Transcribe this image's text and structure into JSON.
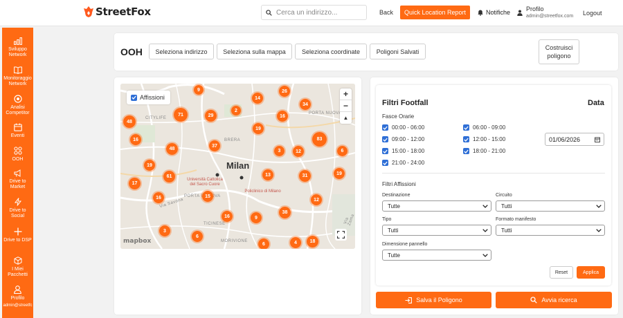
{
  "header": {
    "brand": "StreetFox",
    "search_placeholder": "Cerca un indirizzo...",
    "back": "Back",
    "quick_report": "Quick Location Report",
    "notifications": "Notifiche",
    "profile_name": "Profilo",
    "profile_email": "admin@streetfox.com",
    "logout": "Logout"
  },
  "sidebar": {
    "items": [
      {
        "label": "Sviluppo Network",
        "icon": "bar-chart-icon"
      },
      {
        "label": "Monitoraggio Network",
        "icon": "book-icon"
      },
      {
        "label": "Analisi Competitor",
        "icon": "target-icon"
      },
      {
        "label": "Eventi",
        "icon": "calendar-icon"
      },
      {
        "label": "OOH",
        "icon": "grid-icon"
      },
      {
        "label": "Drive to Market",
        "icon": "megaphone-icon"
      },
      {
        "label": "Drive to Social",
        "icon": "bolt-icon"
      },
      {
        "label": "Drive to DSP",
        "icon": "plus-icon"
      },
      {
        "label": "I Miei Pacchetti",
        "icon": "box-icon"
      },
      {
        "label": "Profilo",
        "icon": "user-icon"
      },
      {
        "label": "admin@streetfc",
        "icon": ""
      }
    ]
  },
  "toolbar": {
    "title": "OOH",
    "tabs": [
      "Seleziona indirizzo",
      "Seleziona sulla mappa",
      "Seleziona coordinate",
      "Poligoni Salvati"
    ],
    "build_polygon": "Costruisci poligono"
  },
  "map": {
    "layer_toggle": "Affissioni",
    "city": "Milan",
    "attribution": "mapbox",
    "labels": {
      "citylife": "CITYLIFE",
      "brera": "BRERA",
      "portanuova": "PORTA NUOVA",
      "porta_genova": "PORTA GENOVA",
      "morivione": "MORIVIONE",
      "ticinese": "TICINESE",
      "via_savona": "Via Savona",
      "via_zama": "Via Zama"
    },
    "pois": [
      {
        "label": "Università Cattolica del Sacro Cuore"
      },
      {
        "label": "Policlinico di Milano"
      }
    ],
    "clusters": [
      {
        "count": "9"
      },
      {
        "count": "26"
      },
      {
        "count": "14"
      },
      {
        "count": "34"
      },
      {
        "count": "48"
      },
      {
        "count": "71"
      },
      {
        "count": "29"
      },
      {
        "count": "2"
      },
      {
        "count": "16"
      },
      {
        "count": "19"
      },
      {
        "count": "16"
      },
      {
        "count": "83"
      },
      {
        "count": "6"
      },
      {
        "count": "48"
      },
      {
        "count": "37"
      },
      {
        "count": "3"
      },
      {
        "count": "12"
      },
      {
        "count": "19"
      },
      {
        "count": "61"
      },
      {
        "count": "13"
      },
      {
        "count": "31"
      },
      {
        "count": "19"
      },
      {
        "count": "17"
      },
      {
        "count": "16"
      },
      {
        "count": "15"
      },
      {
        "count": "12"
      },
      {
        "count": "38"
      },
      {
        "count": "16"
      },
      {
        "count": "9"
      },
      {
        "count": "3"
      },
      {
        "count": "6"
      },
      {
        "count": "6"
      },
      {
        "count": "4"
      },
      {
        "count": "18"
      }
    ]
  },
  "filters": {
    "title": "Filtri Footfall",
    "date_title": "Data",
    "fasce_label": "Fasce Orarie",
    "slots": [
      "00:00 - 06:00",
      "06:00 - 09:00",
      "09:00 - 12:00",
      "12:00 - 15:00",
      "15:00 - 18:00",
      "18:00 - 21:00",
      "21:00 - 24:00"
    ],
    "date_value": "01/06/2026",
    "affissioni_label": "Filtri Affissioni",
    "fields": [
      {
        "label": "Destinazione",
        "value": "Tutte"
      },
      {
        "label": "Circuito",
        "value": "Tutti"
      },
      {
        "label": "Tipo",
        "value": "Tutti"
      },
      {
        "label": "Formato manifesto",
        "value": "Tutti"
      },
      {
        "label": "Dimensione pannello",
        "value": "Tutte"
      }
    ],
    "reset": "Reset",
    "apply": "Applica"
  },
  "actions": {
    "save_polygon": "Salva il Poligono",
    "search": "Avvia ricerca"
  },
  "colors": {
    "accent": "#ff6a13",
    "checkbox": "#2f6fd6"
  }
}
